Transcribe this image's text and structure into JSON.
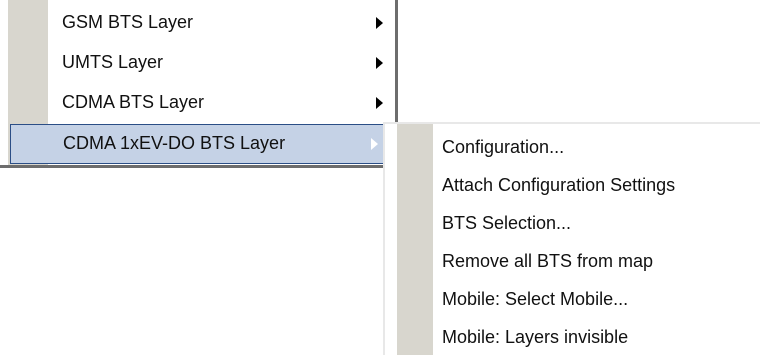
{
  "main_menu": {
    "items": [
      {
        "label": "GSM BTS Layer",
        "has_submenu": true
      },
      {
        "label": "UMTS Layer",
        "has_submenu": true
      },
      {
        "label": "CDMA BTS Layer",
        "has_submenu": true
      },
      {
        "label": "CDMA 1xEV-DO BTS Layer",
        "has_submenu": true,
        "selected": true
      }
    ]
  },
  "submenu": {
    "items": [
      {
        "label": "Configuration..."
      },
      {
        "label": "Attach Configuration Settings"
      },
      {
        "label": "BTS Selection..."
      },
      {
        "label": "Remove all BTS from map"
      },
      {
        "label": "Mobile: Select Mobile..."
      },
      {
        "label": "Mobile: Layers invisible"
      }
    ]
  },
  "colors": {
    "gutter": "#d8d6ce",
    "selection_fill": "#c5d2e6",
    "selection_border": "#2b4e86",
    "menu_border": "#6d6d6d"
  }
}
